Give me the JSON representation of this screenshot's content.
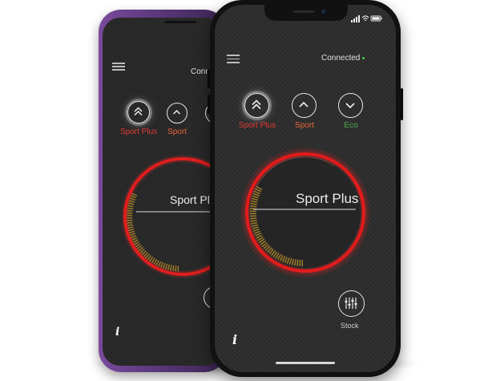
{
  "status": {
    "connection_label": "Connected"
  },
  "modes": [
    {
      "label": "Sport Plus",
      "color": "#e53935",
      "icon": "double-chevron-up-icon",
      "active": true
    },
    {
      "label": "Sport",
      "color": "#e8643a",
      "icon": "chevron-up-icon",
      "active": false
    },
    {
      "label": "Eco",
      "color": "#4caf50",
      "icon": "chevron-down-icon",
      "active": false
    }
  ],
  "dial": {
    "mode_name": "Sport Plus",
    "ring_color": "#e31b1b",
    "progress_color": "#b08a2a"
  },
  "stock_button": {
    "label": "Stock",
    "icon": "sliders-icon"
  },
  "info_label": "i",
  "colors": {
    "back_phone_frame": "#6b3f8c",
    "screen_bg": "#2a2a2a",
    "connected_dot": "#3fd24a"
  }
}
